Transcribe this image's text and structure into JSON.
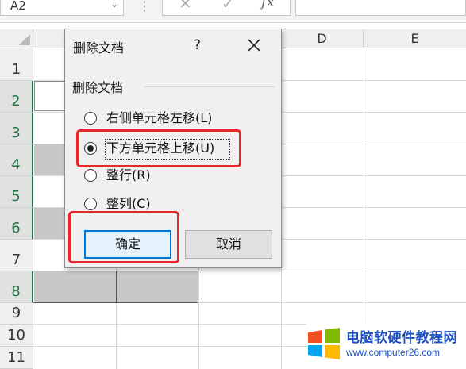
{
  "formula_bar": {
    "name_box_value": "A2",
    "separator": "⋮",
    "cancel_icon": "x-icon",
    "confirm_icon": "check-icon",
    "fx_label": "fx",
    "formula_value": ""
  },
  "sheet": {
    "columns": [
      "",
      "",
      "",
      "D",
      "E"
    ],
    "rows": [
      "1",
      "2",
      "3",
      "4",
      "5",
      "6",
      "7",
      "8",
      "9",
      "10",
      "11"
    ],
    "selected_rows": [
      "2",
      "3",
      "4",
      "5",
      "6",
      "8"
    ]
  },
  "dialog": {
    "title": "删除文档",
    "help": "?",
    "group_label": "删除文档",
    "options": [
      {
        "label": "右侧单元格左移(L)",
        "checked": false
      },
      {
        "label": "下方单元格上移(U)",
        "checked": true
      },
      {
        "label": "整行(R)",
        "checked": false
      },
      {
        "label": "整列(C)",
        "checked": false
      }
    ],
    "ok_label": "确定",
    "cancel_label": "取消"
  },
  "annotation_color": "#e8262d",
  "watermark": {
    "title": "电脑软硬件教程网",
    "url": "www.computer26.com"
  }
}
